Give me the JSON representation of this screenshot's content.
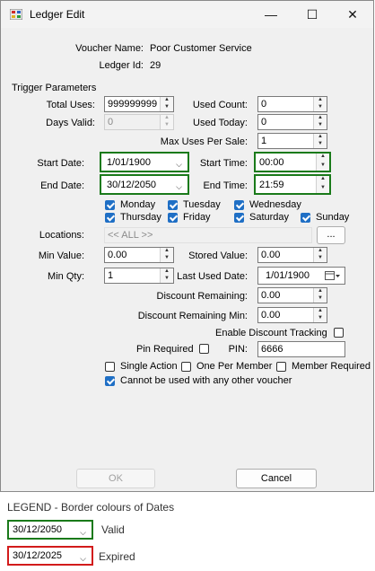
{
  "window": {
    "title": "Ledger Edit",
    "minimize": "—",
    "maximize": "☐",
    "close": "✕"
  },
  "voucher": {
    "name_label": "Voucher Name:",
    "name_value": "Poor Customer Service",
    "ledger_label": "Ledger Id:",
    "ledger_value": "29"
  },
  "trigger": {
    "group_label": "Trigger Parameters",
    "total_uses_label": "Total Uses:",
    "total_uses_value": "999999999",
    "used_count_label": "Used Count:",
    "used_count_value": "0",
    "days_valid_label": "Days Valid:",
    "days_valid_value": "0",
    "used_today_label": "Used Today:",
    "used_today_value": "0",
    "max_uses_label": "Max Uses Per Sale:",
    "max_uses_value": "1",
    "start_date_label": "Start Date:",
    "start_date_value": "1/01/1900",
    "start_time_label": "Start Time:",
    "start_time_value": "00:00",
    "end_date_label": "End Date:",
    "end_date_value": "30/12/2050",
    "end_time_label": "End Time:",
    "end_time_value": "21:59"
  },
  "days": {
    "monday": "Monday",
    "tuesday": "Tuesday",
    "wednesday": "Wednesday",
    "thursday": "Thursday",
    "friday": "Friday",
    "saturday": "Saturday",
    "sunday": "Sunday"
  },
  "locations": {
    "label": "Locations:",
    "value": "<< ALL >>",
    "browse": "..."
  },
  "values": {
    "min_value_label": "Min Value:",
    "min_value": "0.00",
    "stored_value_label": "Stored Value:",
    "stored_value": "0.00",
    "min_qty_label": "Min Qty:",
    "min_qty": "1",
    "last_used_label": "Last Used Date:",
    "last_used_value": "1/01/1900",
    "discount_remaining_label": "Discount Remaining:",
    "discount_remaining": "0.00",
    "discount_remaining_min_label": "Discount Remaining Min:",
    "discount_remaining_min": "0.00",
    "enable_discount_tracking": "Enable Discount  Tracking",
    "pin_required_label": "Pin Required",
    "pin_label": "PIN:",
    "pin_value": "6666"
  },
  "options": {
    "single_action": "Single Action",
    "one_per_member": "One Per Member",
    "member_required": "Member Required",
    "cannot_combine": "Cannot be used with any other voucher"
  },
  "buttons": {
    "ok": "OK",
    "cancel": "Cancel"
  },
  "legend": {
    "title": "LEGEND - Border colours of Dates",
    "valid_date": "30/12/2050",
    "valid_label": "Valid",
    "expired_date": "30/12/2025",
    "expired_label": "Expired",
    "valid_color": "#1a7a1a",
    "expired_color": "#d21b1b"
  }
}
